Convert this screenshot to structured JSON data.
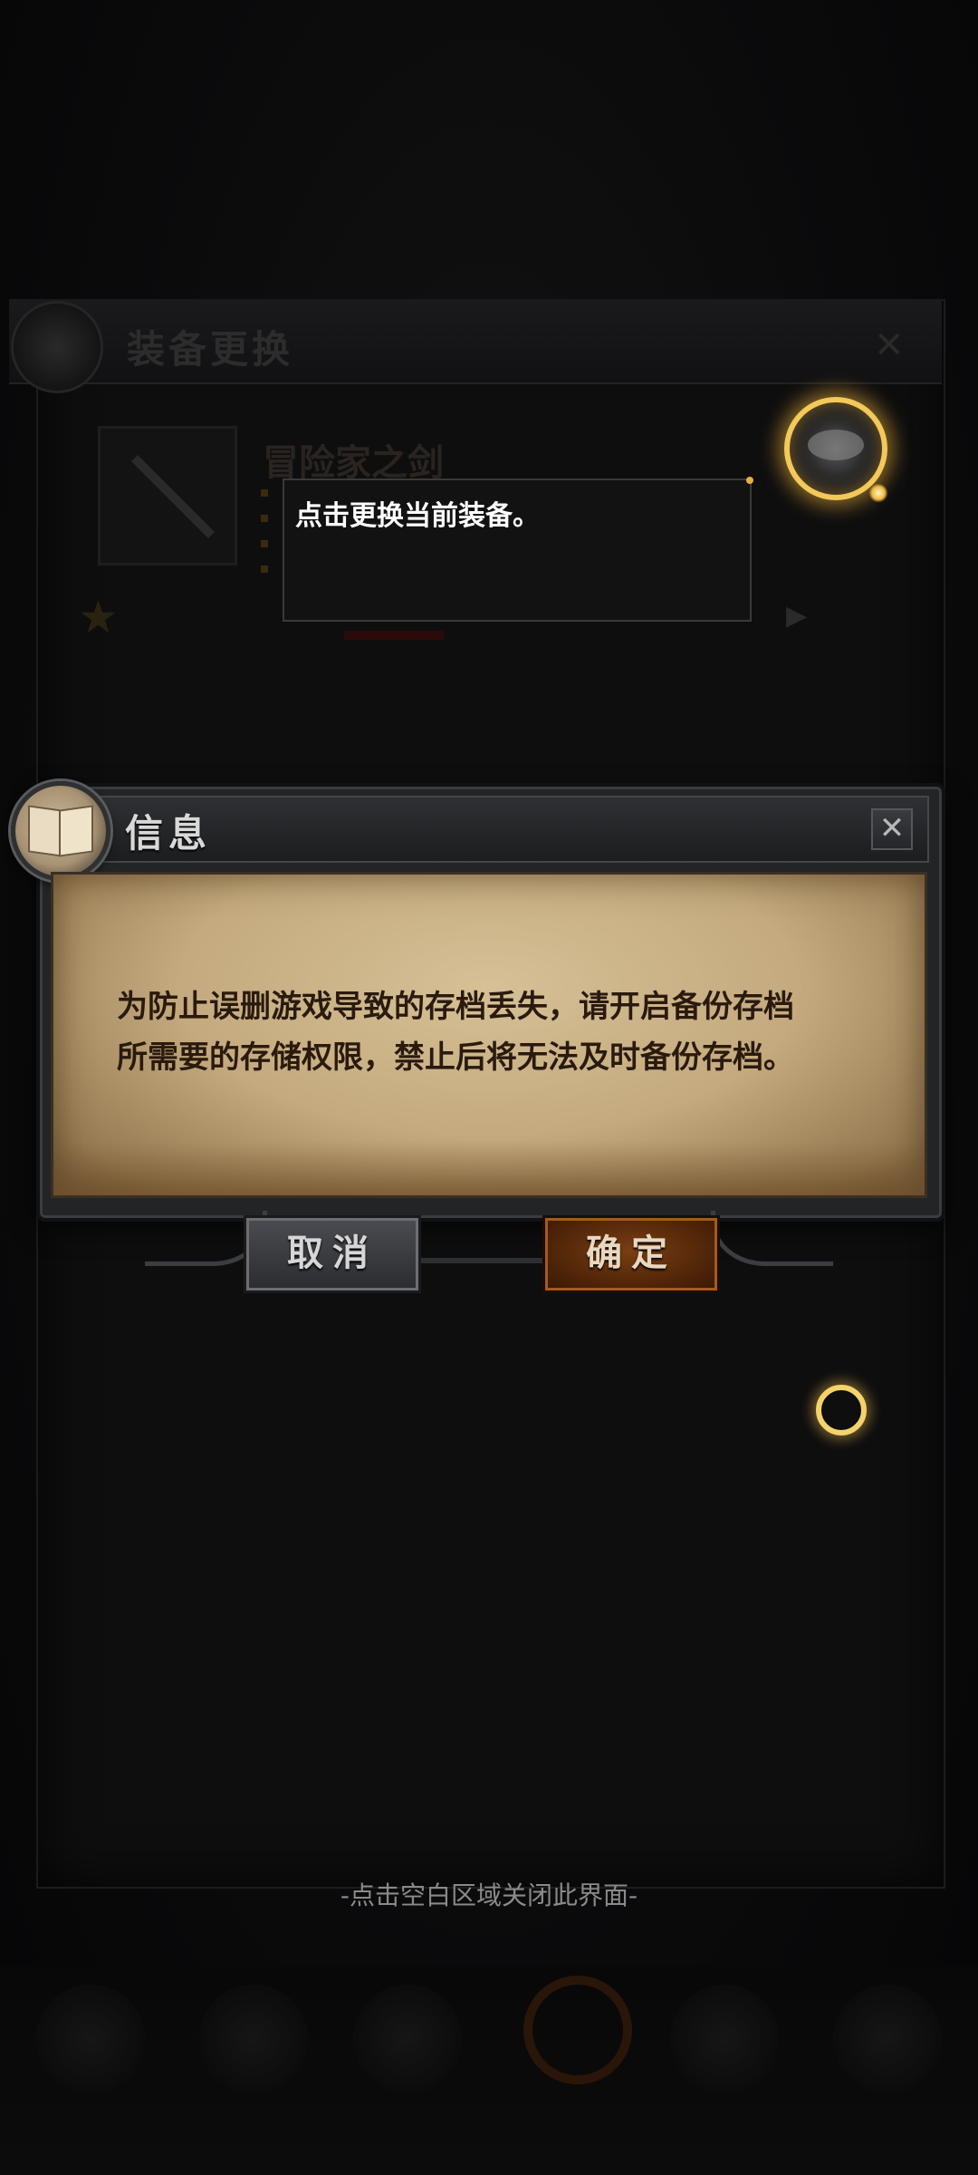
{
  "background": {
    "panel_title": "装备更换",
    "item_name": "冒险家之剑",
    "close_glyph": "✕"
  },
  "tooltip": {
    "text": "点击更换当前装备。"
  },
  "dialog": {
    "title": "信息",
    "close_glyph": "✕",
    "message_line1": "为防止误删游戏导致的存档丢失，请开启备份存档",
    "message_line2": "所需要的存储权限，禁止后将无法及时备份存档。",
    "cancel_label": "取消",
    "confirm_label": "确定"
  },
  "hint": "-点击空白区域关闭此界面-",
  "colors": {
    "accent_gold": "#f3c95a",
    "parchment": "#c4aa7e",
    "confirm_button": "#7a3e12"
  }
}
